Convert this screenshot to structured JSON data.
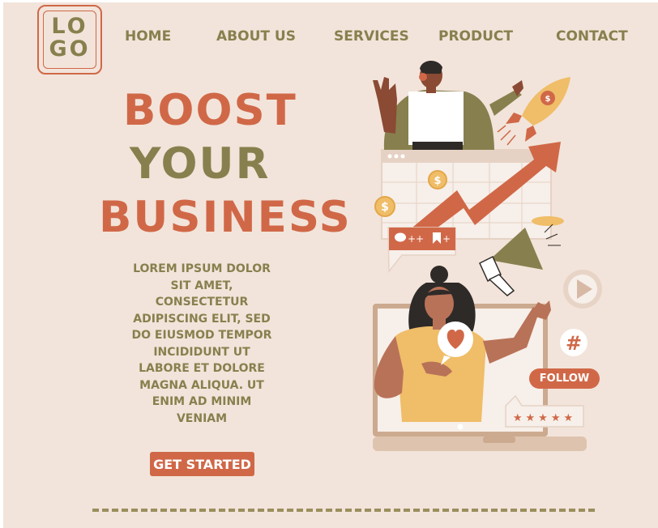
{
  "logo": {
    "line1": "LO",
    "line2": "GO"
  },
  "nav": {
    "home": "HOME",
    "about": "ABOUT US",
    "services": "SERVICES",
    "product": "PRODUCT",
    "contact": "CONTACT"
  },
  "hero": {
    "line1": "BOOST",
    "line2": "YOUR",
    "line3": "BUSINESS"
  },
  "body_text": "LOREM IPSUM DOLOR SIT AMET, CONSECTETUR ADIPISCING ELIT, SED DO EIUSMOD TEMPOR INCIDIDUNT UT LABORE ET DOLORE MAGNA ALIQUA. UT ENIM AD MINIM VENIAM",
  "cta_label": "GET STARTED",
  "illustration": {
    "follow_label": "FOLLOW",
    "hashtag": "#",
    "dollar": "$",
    "comment_badge": "++",
    "bookmark_badge": "+",
    "rating_stars": "★★★★★",
    "icons": [
      "rocket-icon",
      "trend-arrow-icon",
      "megaphone-icon",
      "play-icon",
      "heart-icon",
      "hashtag-icon",
      "star-rating-icon",
      "coin-icon"
    ]
  },
  "colors": {
    "background": "#f2e4da",
    "accent": "#d06848",
    "olive": "#87804e",
    "mustard": "#f0bd68",
    "skin": "#b87258"
  }
}
